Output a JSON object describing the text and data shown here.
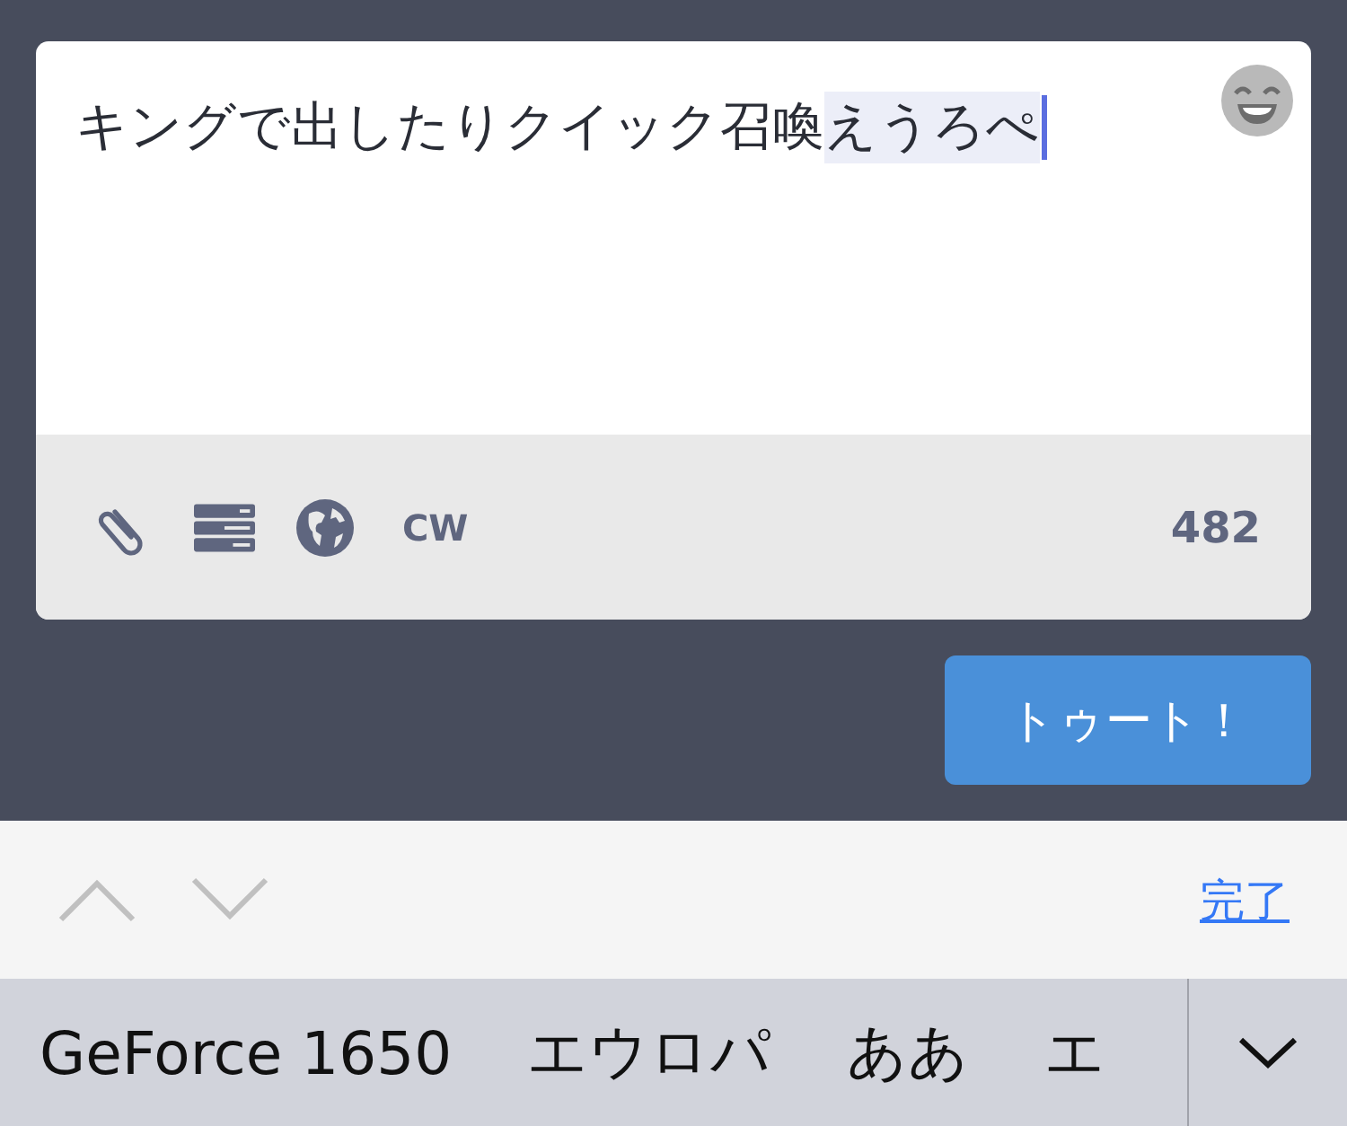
{
  "compose": {
    "text": "キングで出したりクイック召喚",
    "composing": "えうろぺ",
    "cw_label": "CW",
    "char_count": "482"
  },
  "submit_button": {
    "label": "トゥート！"
  },
  "keyboard_toolbar": {
    "done_label": "完了"
  },
  "suggestions": [
    {
      "label": "GeForce 1650"
    },
    {
      "label": "エウロパ"
    },
    {
      "label": "ああ"
    },
    {
      "label": "エ"
    }
  ]
}
